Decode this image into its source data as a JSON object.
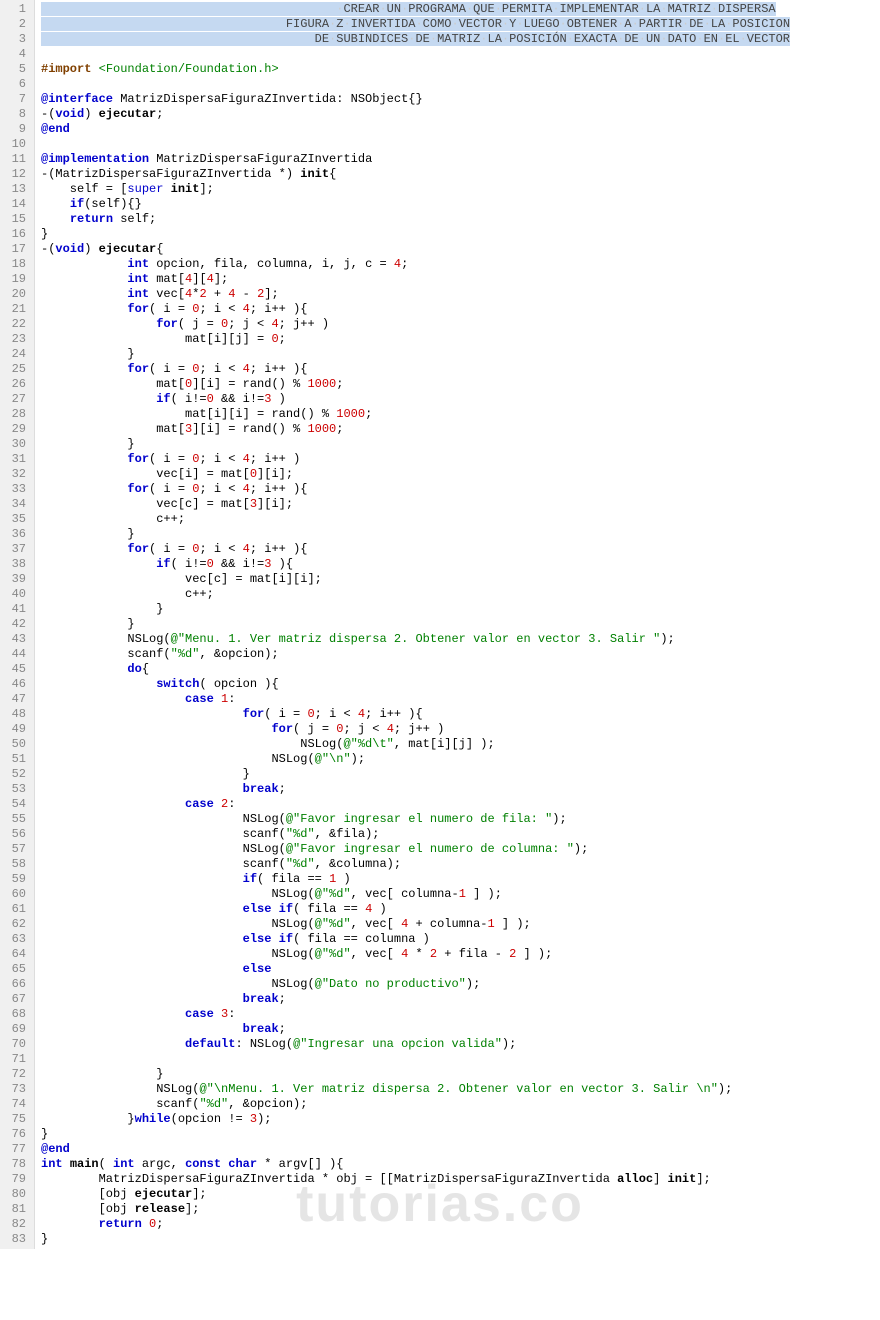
{
  "watermark": "tutorias.co",
  "lines": [
    {
      "n": 1,
      "html": "<span class='comment-hl'>                                         <span class='ws'>·</span>CREAR<span class='ws'>·</span>UN<span class='ws'>·</span>PROGRAMA<span class='ws'>·</span>QUE<span class='ws'>·</span>PERMITA<span class='ws'>·</span>IMPLEMENTAR<span class='ws'>·</span>LA<span class='ws'>·</span>MATRIZ<span class='ws'>·</span>DISPERSA</span>"
    },
    {
      "n": 2,
      "html": "<span class='comment-hl'>                                  FIGURA<span class='ws'>·</span>Z<span class='ws'>·</span>INVERTIDA<span class='ws'>·</span>COMO<span class='ws'>·</span>VECTOR<span class='ws'>·</span>Y<span class='ws'>·</span>LUEGO<span class='ws'>·</span>OBTENER<span class='ws'>·</span>A<span class='ws'>·</span>PARTIR<span class='ws'>·</span>DE<span class='ws'>·</span>LA<span class='ws'>·</span>POSICION</span>"
    },
    {
      "n": 3,
      "html": "<span class='comment-hl'>                                      DE<span class='ws'>·</span>SUBINDICES<span class='ws'>·</span>DE<span class='ws'>·</span>MATRIZ<span class='ws'>·</span>LA<span class='ws'>·</span>POSICIÓN<span class='ws'>·</span>EXACTA<span class='ws'>·</span>DE<span class='ws'>·</span>UN<span class='ws'>·</span>DATO<span class='ws'>·</span>EN<span class='ws'>·</span>EL<span class='ws'>·</span>VECTOR</span>"
    },
    {
      "n": 4,
      "html": ""
    },
    {
      "n": 5,
      "html": "<span class='pre'>#import</span> <span class='str'>&lt;Foundation/Foundation.h&gt;</span>"
    },
    {
      "n": 6,
      "html": ""
    },
    {
      "n": 7,
      "html": "<span class='kw'>@interface</span> MatrizDispersaFiguraZInvertida: <span class='id'>NSObject</span>{}"
    },
    {
      "n": 8,
      "html": "-(<span class='kw'>void</span>) <span class='fn'>ejecutar</span>;"
    },
    {
      "n": 9,
      "html": "<span class='kw'>@end</span>"
    },
    {
      "n": 10,
      "html": ""
    },
    {
      "n": 11,
      "html": "<span class='kw'>@implementation</span> MatrizDispersaFiguraZInvertida"
    },
    {
      "n": 12,
      "html": "-(MatrizDispersaFiguraZInvertida *) <span class='fn'>init</span>{"
    },
    {
      "n": 13,
      "html": "    self = [<span class='kw2'>super</span> <span class='fn'>init</span>];"
    },
    {
      "n": 14,
      "html": "    <span class='kw'>if</span>(self){}"
    },
    {
      "n": 15,
      "html": "    <span class='kw'>return</span> self;"
    },
    {
      "n": 16,
      "html": "}"
    },
    {
      "n": 17,
      "html": "-(<span class='kw'>void</span>) <span class='fn'>ejecutar</span>{"
    },
    {
      "n": 18,
      "html": "            <span class='kw'>int</span> opcion, fila, columna, i, j, c = <span class='num'>4</span>;"
    },
    {
      "n": 19,
      "html": "            <span class='kw'>int</span> mat[<span class='num'>4</span>][<span class='num'>4</span>];"
    },
    {
      "n": 20,
      "html": "            <span class='kw'>int</span> vec[<span class='num'>4</span>*<span class='num'>2</span> + <span class='num'>4</span> - <span class='num'>2</span>];"
    },
    {
      "n": 21,
      "html": "            <span class='kw'>for</span>( i = <span class='num'>0</span>; i &lt; <span class='num'>4</span>; i++ ){"
    },
    {
      "n": 22,
      "html": "                <span class='kw'>for</span>( j = <span class='num'>0</span>; j &lt; <span class='num'>4</span>; j++ )"
    },
    {
      "n": 23,
      "html": "                    mat[i][j] = <span class='num'>0</span>;"
    },
    {
      "n": 24,
      "html": "            }"
    },
    {
      "n": 25,
      "html": "            <span class='kw'>for</span>( i = <span class='num'>0</span>; i &lt; <span class='num'>4</span>; i++ ){"
    },
    {
      "n": 26,
      "html": "                mat[<span class='num'>0</span>][i] = rand() % <span class='num'>1000</span>;"
    },
    {
      "n": 27,
      "html": "                <span class='kw'>if</span>( i!=<span class='num'>0</span> &amp;&amp; i!=<span class='num'>3</span> )"
    },
    {
      "n": 28,
      "html": "                    mat[i][i] = rand() % <span class='num'>1000</span>;"
    },
    {
      "n": 29,
      "html": "                mat[<span class='num'>3</span>][i] = rand() % <span class='num'>1000</span>;"
    },
    {
      "n": 30,
      "html": "            }"
    },
    {
      "n": 31,
      "html": "            <span class='kw'>for</span>( i = <span class='num'>0</span>; i &lt; <span class='num'>4</span>; i++ )"
    },
    {
      "n": 32,
      "html": "                vec[i] = mat[<span class='num'>0</span>][i];"
    },
    {
      "n": 33,
      "html": "            <span class='kw'>for</span>( i = <span class='num'>0</span>; i &lt; <span class='num'>4</span>; i++ ){"
    },
    {
      "n": 34,
      "html": "                vec[c] = mat[<span class='num'>3</span>][i];"
    },
    {
      "n": 35,
      "html": "                c++;"
    },
    {
      "n": 36,
      "html": "            }"
    },
    {
      "n": 37,
      "html": "            <span class='kw'>for</span>( i = <span class='num'>0</span>; i &lt; <span class='num'>4</span>; i++ ){"
    },
    {
      "n": 38,
      "html": "                <span class='kw'>if</span>( i!=<span class='num'>0</span> &amp;&amp; i!=<span class='num'>3</span> ){"
    },
    {
      "n": 39,
      "html": "                    vec[c] = mat[i][i];"
    },
    {
      "n": 40,
      "html": "                    c++;"
    },
    {
      "n": 41,
      "html": "                }"
    },
    {
      "n": 42,
      "html": "            }"
    },
    {
      "n": 43,
      "html": "            NSLog(<span class='str'>@\"Menu. 1. Ver matriz dispersa 2. Obtener valor en vector 3. Salir \"</span>);"
    },
    {
      "n": 44,
      "html": "            scanf(<span class='str'>\"%d\"</span>, &amp;opcion);"
    },
    {
      "n": 45,
      "html": "            <span class='kw'>do</span>{"
    },
    {
      "n": 46,
      "html": "                <span class='kw'>switch</span>( opcion ){"
    },
    {
      "n": 47,
      "html": "                    <span class='kw'>case</span> <span class='num'>1</span>:"
    },
    {
      "n": 48,
      "html": "                            <span class='kw'>for</span>( i = <span class='num'>0</span>; i &lt; <span class='num'>4</span>; i++ ){"
    },
    {
      "n": 49,
      "html": "                                <span class='kw'>for</span>( j = <span class='num'>0</span>; j &lt; <span class='num'>4</span>; j++ )"
    },
    {
      "n": 50,
      "html": "                                    NSLog(<span class='str'>@\"%d\\t\"</span>, mat[i][j] );"
    },
    {
      "n": 51,
      "html": "                                NSLog(<span class='str'>@\"\\n\"</span>);"
    },
    {
      "n": 52,
      "html": "                            }"
    },
    {
      "n": 53,
      "html": "                            <span class='kw'>break</span>;"
    },
    {
      "n": 54,
      "html": "                    <span class='kw'>case</span> <span class='num'>2</span>:"
    },
    {
      "n": 55,
      "html": "                            NSLog(<span class='str'>@\"Favor ingresar el numero de fila: \"</span>);"
    },
    {
      "n": 56,
      "html": "                            scanf(<span class='str'>\"%d\"</span>, &amp;fila);"
    },
    {
      "n": 57,
      "html": "                            NSLog(<span class='str'>@\"Favor ingresar el numero de columna: \"</span>);"
    },
    {
      "n": 58,
      "html": "                            scanf(<span class='str'>\"%d\"</span>, &amp;columna);"
    },
    {
      "n": 59,
      "html": "                            <span class='kw'>if</span>( fila == <span class='num'>1</span> )"
    },
    {
      "n": 60,
      "html": "                                NSLog(<span class='str'>@\"%d\"</span>, vec[ columna-<span class='num'>1</span> ] );"
    },
    {
      "n": 61,
      "html": "                            <span class='kw'>else if</span>( fila == <span class='num'>4</span> )"
    },
    {
      "n": 62,
      "html": "                                NSLog(<span class='str'>@\"%d\"</span>, vec[ <span class='num'>4</span> + columna-<span class='num'>1</span> ] );"
    },
    {
      "n": 63,
      "html": "                            <span class='kw'>else if</span>( fila == columna )"
    },
    {
      "n": 64,
      "html": "                                NSLog(<span class='str'>@\"%d\"</span>, vec[ <span class='num'>4</span> * <span class='num'>2</span> + fila - <span class='num'>2</span> ] );"
    },
    {
      "n": 65,
      "html": "                            <span class='kw'>else</span>"
    },
    {
      "n": 66,
      "html": "                                NSLog(<span class='str'>@\"Dato no productivo\"</span>);"
    },
    {
      "n": 67,
      "html": "                            <span class='kw'>break</span>;"
    },
    {
      "n": 68,
      "html": "                    <span class='kw'>case</span> <span class='num'>3</span>:"
    },
    {
      "n": 69,
      "html": "                            <span class='kw'>break</span>;"
    },
    {
      "n": 70,
      "html": "                    <span class='kw'>default</span>: NSLog(<span class='str'>@\"Ingresar una opcion valida\"</span>);"
    },
    {
      "n": 71,
      "html": ""
    },
    {
      "n": 72,
      "html": "                }"
    },
    {
      "n": 73,
      "html": "                NSLog(<span class='str'>@\"\\nMenu. 1. Ver matriz dispersa 2. Obtener valor en vector 3. Salir \\n\"</span>);"
    },
    {
      "n": 74,
      "html": "                scanf(<span class='str'>\"%d\"</span>, &amp;opcion);"
    },
    {
      "n": 75,
      "html": "            }<span class='kw'>while</span>(opcion != <span class='num'>3</span>);"
    },
    {
      "n": 76,
      "html": "}"
    },
    {
      "n": 77,
      "html": "<span class='kw'>@end</span>"
    },
    {
      "n": 78,
      "html": "<span class='kw'>int</span> <span class='fn'>main</span>( <span class='kw'>int</span> argc, <span class='kw'>const char</span> * argv[] ){"
    },
    {
      "n": 79,
      "html": "        MatrizDispersaFiguraZInvertida * obj = [[MatrizDispersaFiguraZInvertida <span class='fn'>alloc</span>] <span class='fn'>init</span>];"
    },
    {
      "n": 80,
      "html": "        [obj <span class='fn'>ejecutar</span>];"
    },
    {
      "n": 81,
      "html": "        [obj <span class='fn'>release</span>];"
    },
    {
      "n": 82,
      "html": "        <span class='kw'>return</span> <span class='num'>0</span>;"
    },
    {
      "n": 83,
      "html": "}"
    }
  ]
}
